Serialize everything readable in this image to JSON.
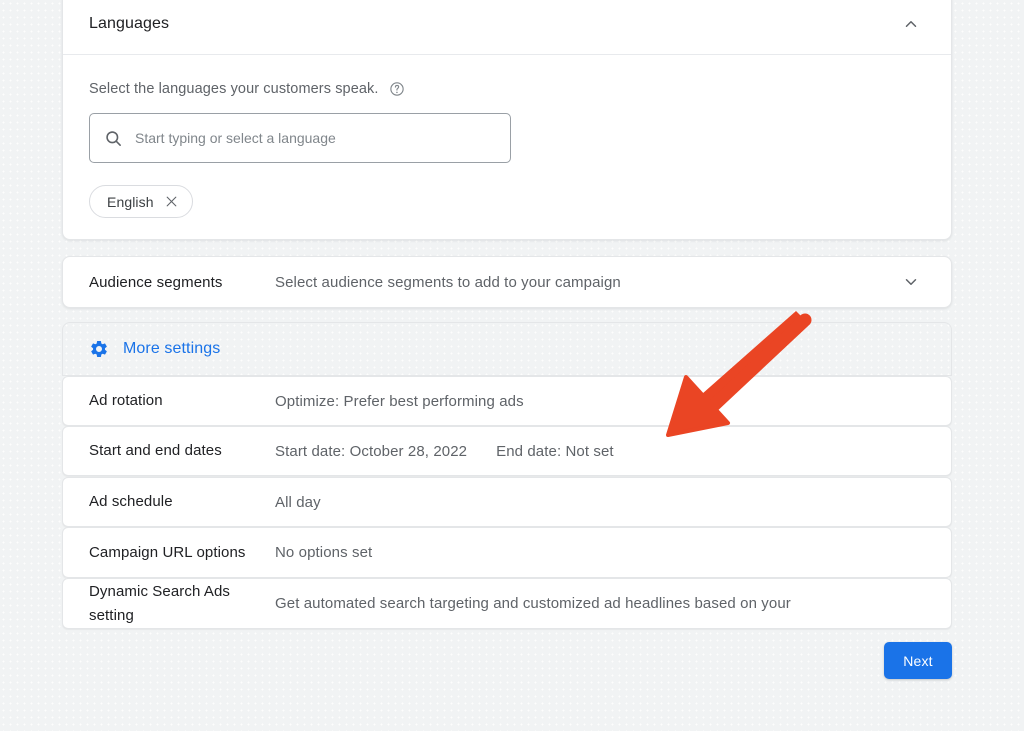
{
  "theme": {
    "accent_blue": "#1a73e8",
    "annotation_red": "#ea4524",
    "page_background": "#f1f3f4",
    "label_color": "#202124",
    "value_color": "#5f6368"
  },
  "languages_card": {
    "title": "Languages",
    "collapse_icon": "chevron-up-icon",
    "helper_text": "Select the languages your customers speak.",
    "help_icon": "help-circle-icon",
    "search": {
      "icon": "search-icon",
      "value": "",
      "placeholder": "Start typing or select a language"
    },
    "chips": [
      {
        "label": "English",
        "remove_icon": "close-icon"
      }
    ]
  },
  "audience_card": {
    "label": "Audience segments",
    "value": "Select audience segments to add to your campaign",
    "expand_icon": "chevron-down-icon"
  },
  "more_settings": {
    "icon": "gear-icon",
    "label": "More settings",
    "rows": [
      {
        "label": "Ad rotation",
        "values": [
          "Optimize: Prefer best performing ads"
        ]
      },
      {
        "label": "Start and end dates",
        "values": [
          "Start date: October 28, 2022",
          "End date: Not set"
        ]
      },
      {
        "label": "Ad schedule",
        "values": [
          "All day"
        ]
      },
      {
        "label": "Campaign URL options",
        "values": [
          "No options set"
        ]
      },
      {
        "label": "Dynamic Search Ads setting",
        "values": [
          "Get automated search targeting and customized ad headlines based on your"
        ]
      }
    ]
  },
  "footer": {
    "next_label": "Next"
  },
  "annotation": {
    "type": "arrow",
    "color": "#ea4524",
    "points_to": "End date: Not set"
  }
}
